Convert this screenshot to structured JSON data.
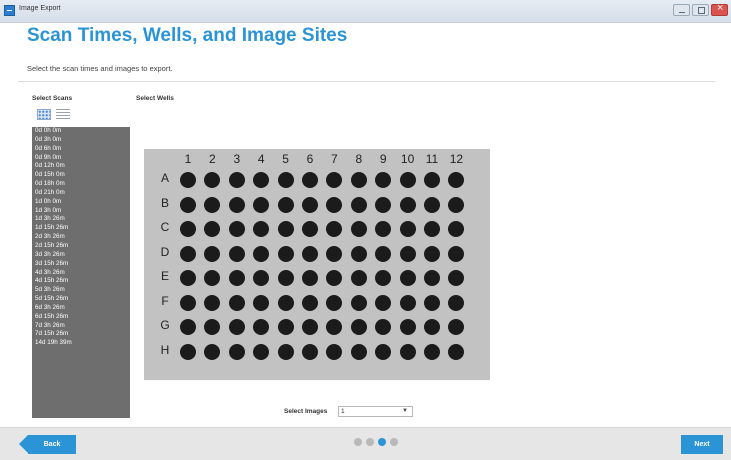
{
  "window": {
    "title": "Image Export"
  },
  "page": {
    "title": "Scan Times, Wells, and Image Sites",
    "subtitle": "Select the scan times and images to export."
  },
  "scans": {
    "label": "Select Scans",
    "items": [
      "0d 0h 0m",
      "0d 3h 0m",
      "0d 6h 0m",
      "0d 9h 0m",
      "0d 12h 0m",
      "0d 15h 0m",
      "0d 18h 0m",
      "0d 21h 0m",
      "1d 0h 0m",
      "1d 3h 0m",
      "1d 3h 26m",
      "1d 15h 26m",
      "2d 3h 26m",
      "2d 15h 26m",
      "3d 3h 26m",
      "3d 15h 26m",
      "4d 3h 26m",
      "4d 15h 26m",
      "5d 3h 26m",
      "5d 15h 26m",
      "6d 3h 26m",
      "6d 15h 26m",
      "7d 3h 26m",
      "7d 15h 26m",
      "14d 19h 39m"
    ]
  },
  "wells": {
    "label": "Select Wells",
    "columns": [
      "1",
      "2",
      "3",
      "4",
      "5",
      "6",
      "7",
      "8",
      "9",
      "10",
      "11",
      "12"
    ],
    "rows": [
      "A",
      "B",
      "C",
      "D",
      "E",
      "F",
      "G",
      "H"
    ]
  },
  "images": {
    "label": "Select Images",
    "value": "1"
  },
  "wizard": {
    "steps": 4,
    "current_step": 3
  },
  "buttons": {
    "back": "Back",
    "next": "Next"
  },
  "colors": {
    "accent": "#2b94d6",
    "scan_list_bg": "#6e6e6e",
    "plate_bg": "#c2c2c2",
    "well": "#1b1b1b"
  }
}
